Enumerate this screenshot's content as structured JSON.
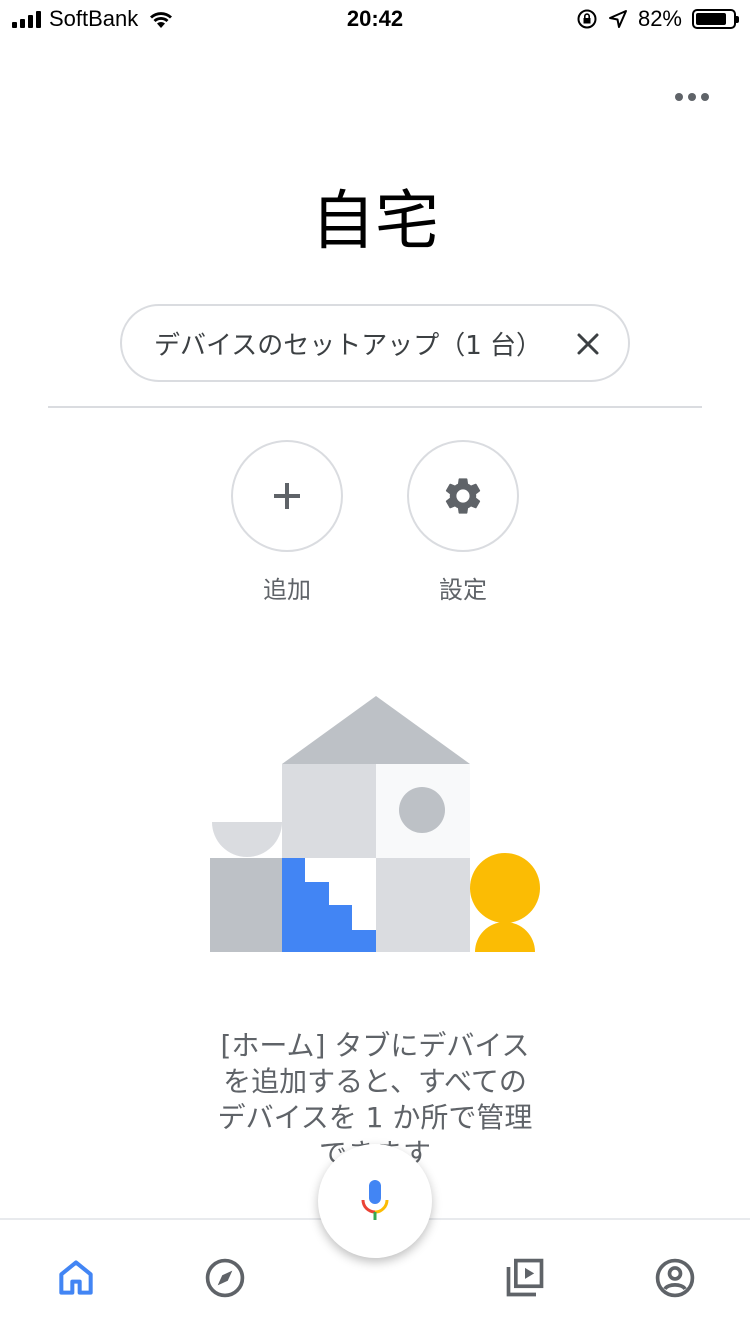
{
  "status_bar": {
    "carrier": "SoftBank",
    "time": "20:42",
    "battery_percent": "82%",
    "battery_level": 0.82
  },
  "header": {
    "title": "自宅",
    "more_icon": "more-horiz-icon"
  },
  "setup_chip": {
    "label": "デバイスのセットアップ（1 台）",
    "close_icon": "close-icon"
  },
  "actions": [
    {
      "label": "追加",
      "icon": "plus-icon"
    },
    {
      "label": "設定",
      "icon": "gear-icon"
    }
  ],
  "empty_state": {
    "line1": "[ホーム] タブにデバイス",
    "line2": "を追加すると、すべての",
    "line3": "デバイスを 1 か所で管理",
    "line4": "できます"
  },
  "bottom_nav": {
    "items": [
      "home-icon",
      "explore-icon",
      "media-icon",
      "account-icon"
    ],
    "active": "home-icon",
    "fab_icon": "mic-icon"
  },
  "colors": {
    "accent_blue": "#4285f4",
    "yellow": "#fbbc04",
    "red": "#ea4335",
    "green": "#34a853",
    "gray": "#5f6368"
  }
}
